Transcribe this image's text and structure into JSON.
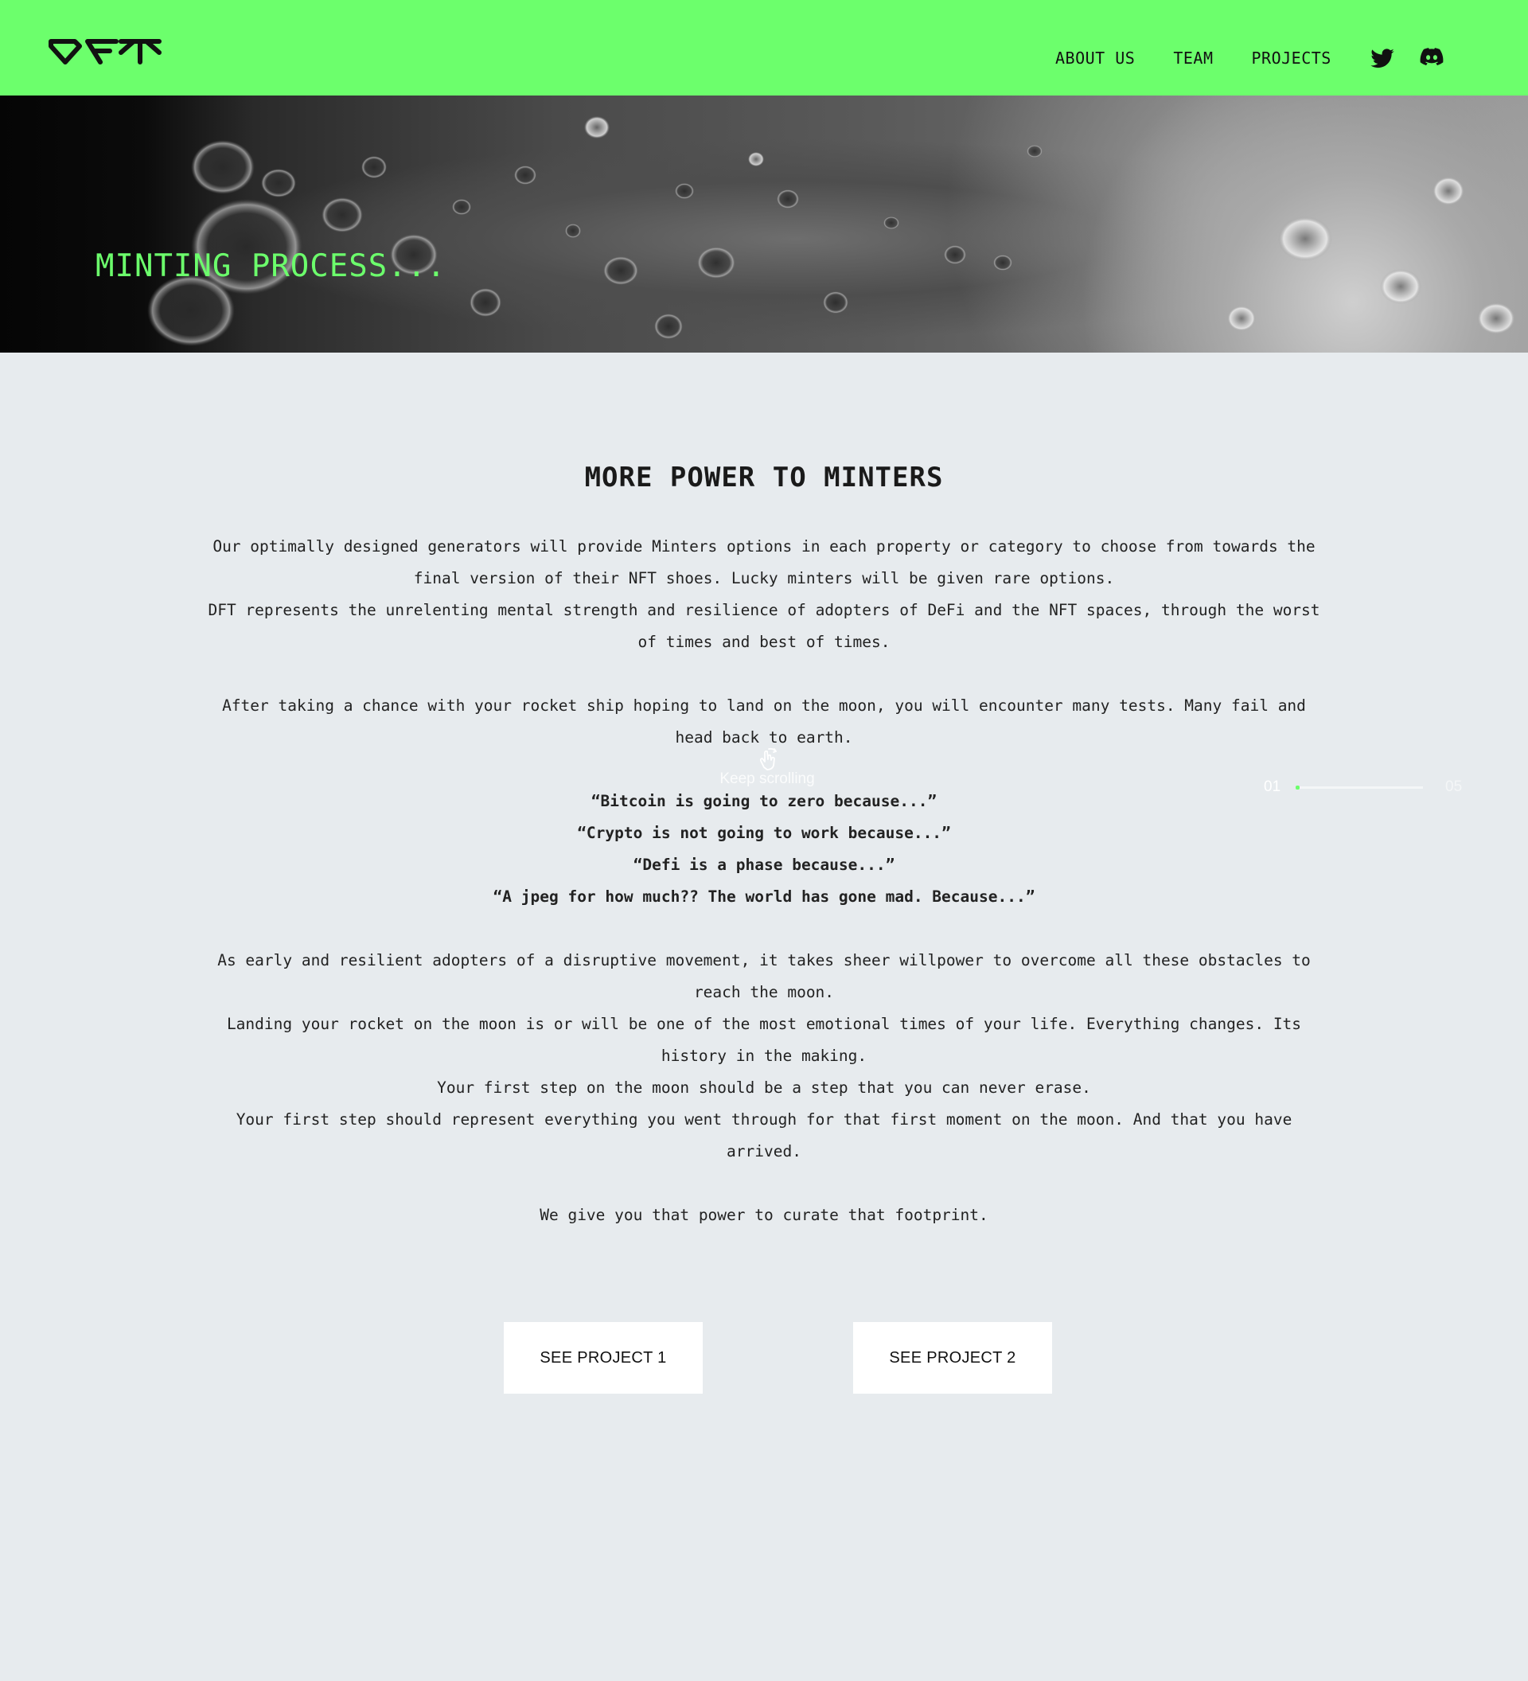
{
  "colors": {
    "accent_green": "#6cff6c",
    "page_background": "#e7ebee",
    "text_dark": "#1a1a1a",
    "button_background": "#ffffff"
  },
  "header": {
    "logo_text": "DFT",
    "nav": [
      {
        "label": "ABOUT US"
      },
      {
        "label": "TEAM"
      },
      {
        "label": "PROJECTS"
      }
    ],
    "social_icons": [
      "twitter-icon",
      "discord-icon"
    ]
  },
  "hero": {
    "title": "MINTING PROCESS..."
  },
  "main": {
    "title": "MORE POWER TO MINTERS",
    "paragraph_1": [
      "Our optimally designed generators will provide Minters options in each property or category to choose from towards the final version of their NFT shoes. Lucky minters will be given rare options.",
      "DFT represents the unrelenting mental strength and resilience of adopters of DeFi and the NFT spaces, through the worst of times and best of times."
    ],
    "paragraph_2": "After taking a chance with your rocket ship hoping to land on the moon, you will encounter many tests. Many fail and head back to earth.",
    "quotes": [
      "“Bitcoin is going to zero because...”",
      "“Crypto is not going to work because...”",
      "“Defi is a phase because...”",
      "“A jpeg for how much?? The world has gone mad. Because...”"
    ],
    "paragraph_3": [
      "As early and resilient adopters of a disruptive movement, it takes sheer willpower to overcome all these obstacles to reach the moon.",
      "Landing your rocket on the moon is or will be one of the most emotional times of your life. Everything changes. Its history in the making.",
      "Your first step on the moon should be a step that you can never erase.",
      "Your first step should represent everything you went through for that first moment on the moon. And that you have arrived."
    ],
    "paragraph_4": "We give you that power to curate that footprint."
  },
  "scroll_indicator": {
    "label": "Keep scrolling",
    "icon": "hand-swipe-icon",
    "progress_start": "01",
    "progress_end": "05",
    "progress_fraction": 0.03
  },
  "buttons": {
    "project_1": "SEE PROJECT 1",
    "project_2": "SEE PROJECT 2"
  }
}
